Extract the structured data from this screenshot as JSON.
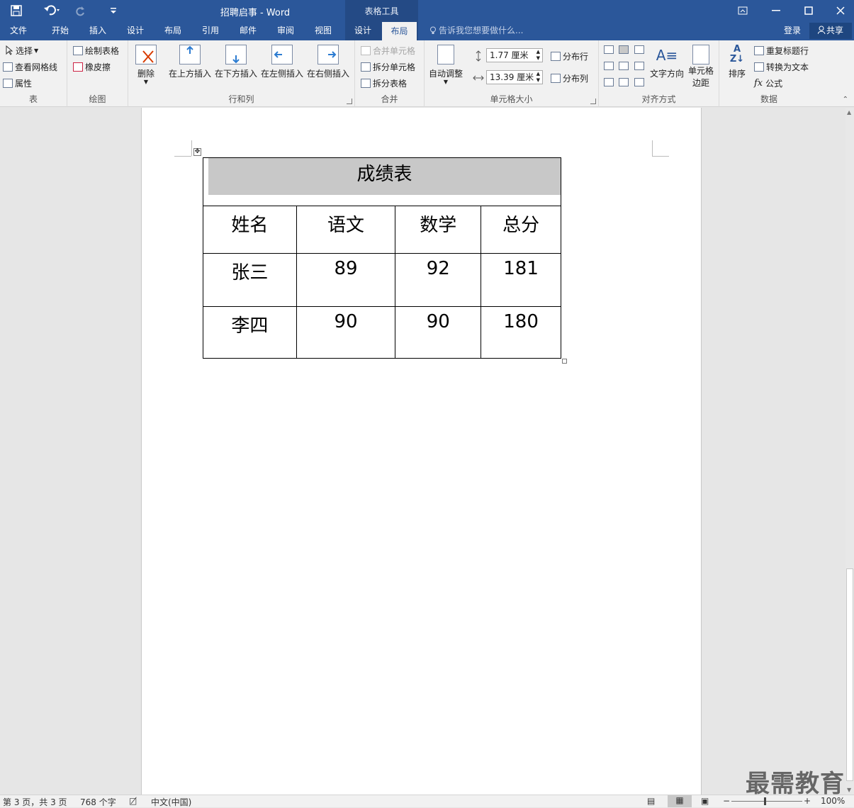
{
  "window": {
    "title": "招聘启事 - Word",
    "context_header": "表格工具"
  },
  "tabs": [
    "文件",
    "开始",
    "插入",
    "设计",
    "布局",
    "引用",
    "邮件",
    "审阅",
    "视图"
  ],
  "context_tabs": [
    "设计",
    "布局"
  ],
  "tell_me": "告诉我您想要做什么...",
  "account": {
    "signin": "登录",
    "share": "共享"
  },
  "ribbon": {
    "table": {
      "label": "表",
      "select": "选择",
      "gridlines": "查看网格线",
      "properties": "属性"
    },
    "draw": {
      "label": "绘图",
      "draw_table": "绘制表格",
      "eraser": "橡皮擦"
    },
    "rows_cols": {
      "label": "行和列",
      "delete": "删除",
      "insert_above": "在上方插入",
      "insert_below": "在下方插入",
      "insert_left": "在左侧插入",
      "insert_right": "在右侧插入"
    },
    "merge": {
      "label": "合并",
      "merge_cells": "合并单元格",
      "split_cells": "拆分单元格",
      "split_table": "拆分表格"
    },
    "cell_size": {
      "label": "单元格大小",
      "autofit": "自动调整",
      "height": "1.77 厘米",
      "width": "13.39 厘米",
      "distribute_rows": "分布行",
      "distribute_cols": "分布列"
    },
    "alignment": {
      "label": "对齐方式",
      "text_direction": "文字方向",
      "cell_margins_1": "单元格",
      "cell_margins_2": "边距"
    },
    "data": {
      "label": "数据",
      "sort": "排序",
      "repeat_header": "重复标题行",
      "convert": "转换为文本",
      "formula": "公式"
    }
  },
  "document": {
    "table_title": "成绩表",
    "headers": [
      "姓名",
      "语文",
      "数学",
      "总分"
    ],
    "rows": [
      [
        "张三",
        "89",
        "92",
        "181"
      ],
      [
        "李四",
        "90",
        "90",
        "180"
      ]
    ]
  },
  "status": {
    "page": "第 3 页，共 3 页",
    "words": "768 个字",
    "lang": "中文(中国)",
    "zoom": "100%"
  },
  "watermark": "最需教育"
}
